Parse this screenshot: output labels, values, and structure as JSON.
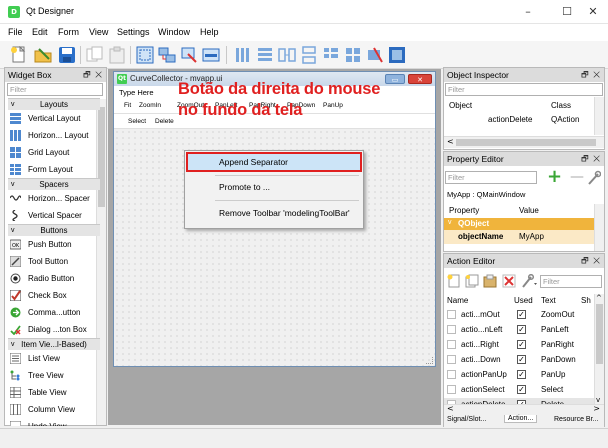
{
  "app": {
    "title": "Qt Designer"
  },
  "window_controls": {
    "minimize": "–",
    "maximize": "☐",
    "close": "✕"
  },
  "menubar": [
    "File",
    "Edit",
    "Form",
    "View",
    "Settings",
    "Window",
    "Help"
  ],
  "widget_box": {
    "title": "Widget Box",
    "filter_placeholder": "Filter",
    "categories": {
      "layouts": "Layouts",
      "spacers": "Spacers",
      "buttons": "Buttons",
      "item_views": "Item Vie...l-Based)"
    },
    "items": {
      "vertical_layout": "Vertical Layout",
      "horizontal_layout": "Horizon... Layout",
      "grid_layout": "Grid Layout",
      "form_layout": "Form Layout",
      "horizontal_spacer": "Horizon... Spacer",
      "vertical_spacer": "Vertical Spacer",
      "push_button": "Push Button",
      "tool_button": "Tool Button",
      "radio_button": "Radio Button",
      "check_box": "Check Box",
      "command_link": "Comma...utton",
      "dialog_button_box": "Dialog ...ton Box",
      "list_view": "List View",
      "tree_view": "Tree View",
      "table_view": "Table View",
      "column_view": "Column View",
      "undo_view": "Undo View"
    }
  },
  "form_window": {
    "title": "CurveCollector - mvapp.ui",
    "menu_placeholder": "Type Here",
    "toolbar1": [
      "Fit",
      "ZoomIn",
      "ZoomOut",
      "PanLeft",
      "PanRight",
      "PanDown",
      "PanUp"
    ],
    "toolbar2": [
      "Select",
      "Delete"
    ]
  },
  "context_menu": {
    "items": [
      "Append Separator",
      "Promote to ...",
      "Remove Toolbar 'modelingToolBar'"
    ]
  },
  "annotation": {
    "line1": "Botão da direita do mouse",
    "line2": "no fundo da tela",
    "color": "#e02020"
  },
  "object_inspector": {
    "title": "Object Inspector",
    "filter_placeholder": "Filter",
    "columns": [
      "Object",
      "Class"
    ],
    "row": {
      "object": "actionDelete",
      "class": "QAction"
    }
  },
  "property_editor": {
    "title": "Property Editor",
    "filter_placeholder": "Filter",
    "context": "MyApp : QMainWindow",
    "columns": [
      "Property",
      "Value"
    ],
    "group": "QObject",
    "property": {
      "name": "objectName",
      "value": "MyApp"
    }
  },
  "action_editor": {
    "title": "Action Editor",
    "filter_placeholder": "Filter",
    "columns": [
      "Name",
      "Used",
      "Text",
      "Sh"
    ],
    "rows": [
      {
        "name": "acti...mOut",
        "used": true,
        "text": "ZoomOut"
      },
      {
        "name": "actio...nLeft",
        "used": true,
        "text": "PanLeft"
      },
      {
        "name": "acti...Right",
        "used": true,
        "text": "PanRight"
      },
      {
        "name": "acti...Down",
        "used": true,
        "text": "PanDown"
      },
      {
        "name": "actionPanUp",
        "used": true,
        "text": "PanUp"
      },
      {
        "name": "actionSelect",
        "used": true,
        "text": "Select"
      },
      {
        "name": "actionDelete",
        "used": true,
        "text": "Delete"
      }
    ],
    "tabs": [
      "Signal/Slot...",
      "Action...",
      "Resource Br..."
    ]
  },
  "colors": {
    "highlight_border": "#e02020",
    "menu_hover": "#cce4f7",
    "qt_green": "#41cd52"
  }
}
